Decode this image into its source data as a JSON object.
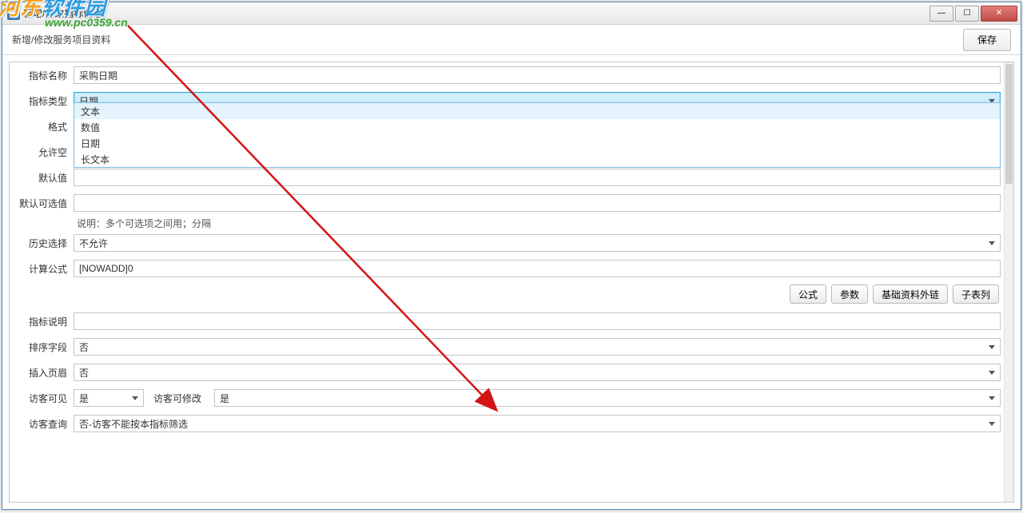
{
  "window": {
    "title": "新增/修改指标信息"
  },
  "toolbar": {
    "title": "新增/修改服务项目资料",
    "save_label": "保存"
  },
  "watermark": {
    "line1_a": "河东",
    "line1_b": "软件园",
    "url": "www.pc0359.cn"
  },
  "labels": {
    "name": "指标名称",
    "type": "指标类型",
    "format": "格式",
    "allow_empty": "允许空",
    "default": "默认值",
    "default_options": "默认可选值",
    "history": "历史选择",
    "formula": "计算公式",
    "desc": "指标说明",
    "sort": "排序字段",
    "header": "插入页眉",
    "guest_visible": "访客可见",
    "guest_editable": "访客可修改",
    "guest_query": "访客查询"
  },
  "values": {
    "name": "采购日期",
    "type": "日期",
    "format": "",
    "allow_empty": "",
    "default": "",
    "default_options": "",
    "history": "不允许",
    "formula": "[NOWADD]0",
    "desc": "",
    "sort": "否",
    "header": "否",
    "guest_visible": "是",
    "guest_editable": "是",
    "guest_query": "否-访客不能按本指标筛选"
  },
  "type_dropdown": {
    "options": [
      "文本",
      "数值",
      "日期",
      "长文本"
    ]
  },
  "hints": {
    "default_options": "说明：多个可选项之间用；分隔"
  },
  "buttons": {
    "formula": "公式",
    "params": "参数",
    "external": "基础资料外链",
    "sublist": "子表列"
  }
}
